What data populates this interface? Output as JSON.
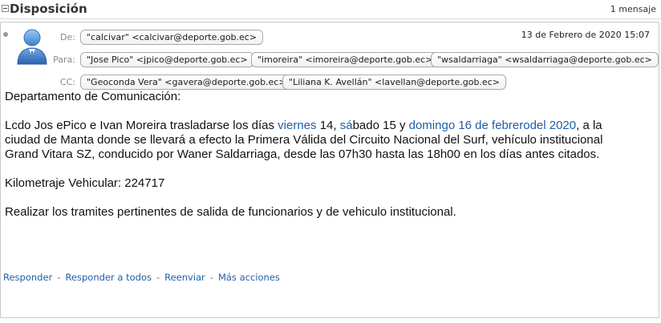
{
  "thread": {
    "title": "Disposición",
    "count": "1 mensaje"
  },
  "message": {
    "from_label": "De:",
    "to_label": "Para:",
    "cc_label": "CC:",
    "from": "\"calcivar\" <calcivar@deporte.gob.ec>",
    "to": [
      "\"Jose Pico\" <jpico@deporte.gob.ec>",
      "\"imoreira\" <imoreira@deporte.gob.ec>",
      "\"wsaldarriaga\" <wsaldarriaga@deporte.gob.ec>"
    ],
    "cc": [
      "\"Geoconda Vera\" <gavera@deporte.gob.ec>",
      "\"Liliana K. Avellán\" <lavellan@deporte.gob.ec>"
    ],
    "date": "13 de Febrero de 2020 15:07"
  },
  "body": {
    "line1": "Departamento de Comunicación:",
    "p2_a": "Lcdo Jos ePico e Ivan Moreira trasladarse los días ",
    "p2_link1": "viernes",
    "p2_b": " 14, ",
    "p2_link2": "sá",
    "p2_c": "bado 15 y ",
    "p2_link3": "domingo 16 de febrerodel 2020",
    "p2_d": ", a la",
    "p2_line2": "ciudad de Manta donde se llevará a efecto la Primera Válida del Circuito Nacional del Surf, vehículo institucional",
    "p2_line3": "Grand Vitara SZ, conducido por Waner Saldarriaga, desde las 07h30 hasta las 18h00 en los días antes citados.",
    "line4": "Kilometraje Vehicular: 224717",
    "line5": "Realizar los tramites pertinentes de salida de funcionarios y de vehiculo institucional."
  },
  "actions": {
    "reply": "Responder",
    "reply_all": "Responder a todos",
    "forward": "Reenviar",
    "more": "Más acciones",
    "separator": "-"
  },
  "icons": {
    "collapse": "collapse-minus-icon",
    "avatar": "user-avatar-icon",
    "status": "status-dot-icon"
  },
  "colors": {
    "link": "#1f5fa6",
    "avatar_blue": "#3b7fd0"
  }
}
